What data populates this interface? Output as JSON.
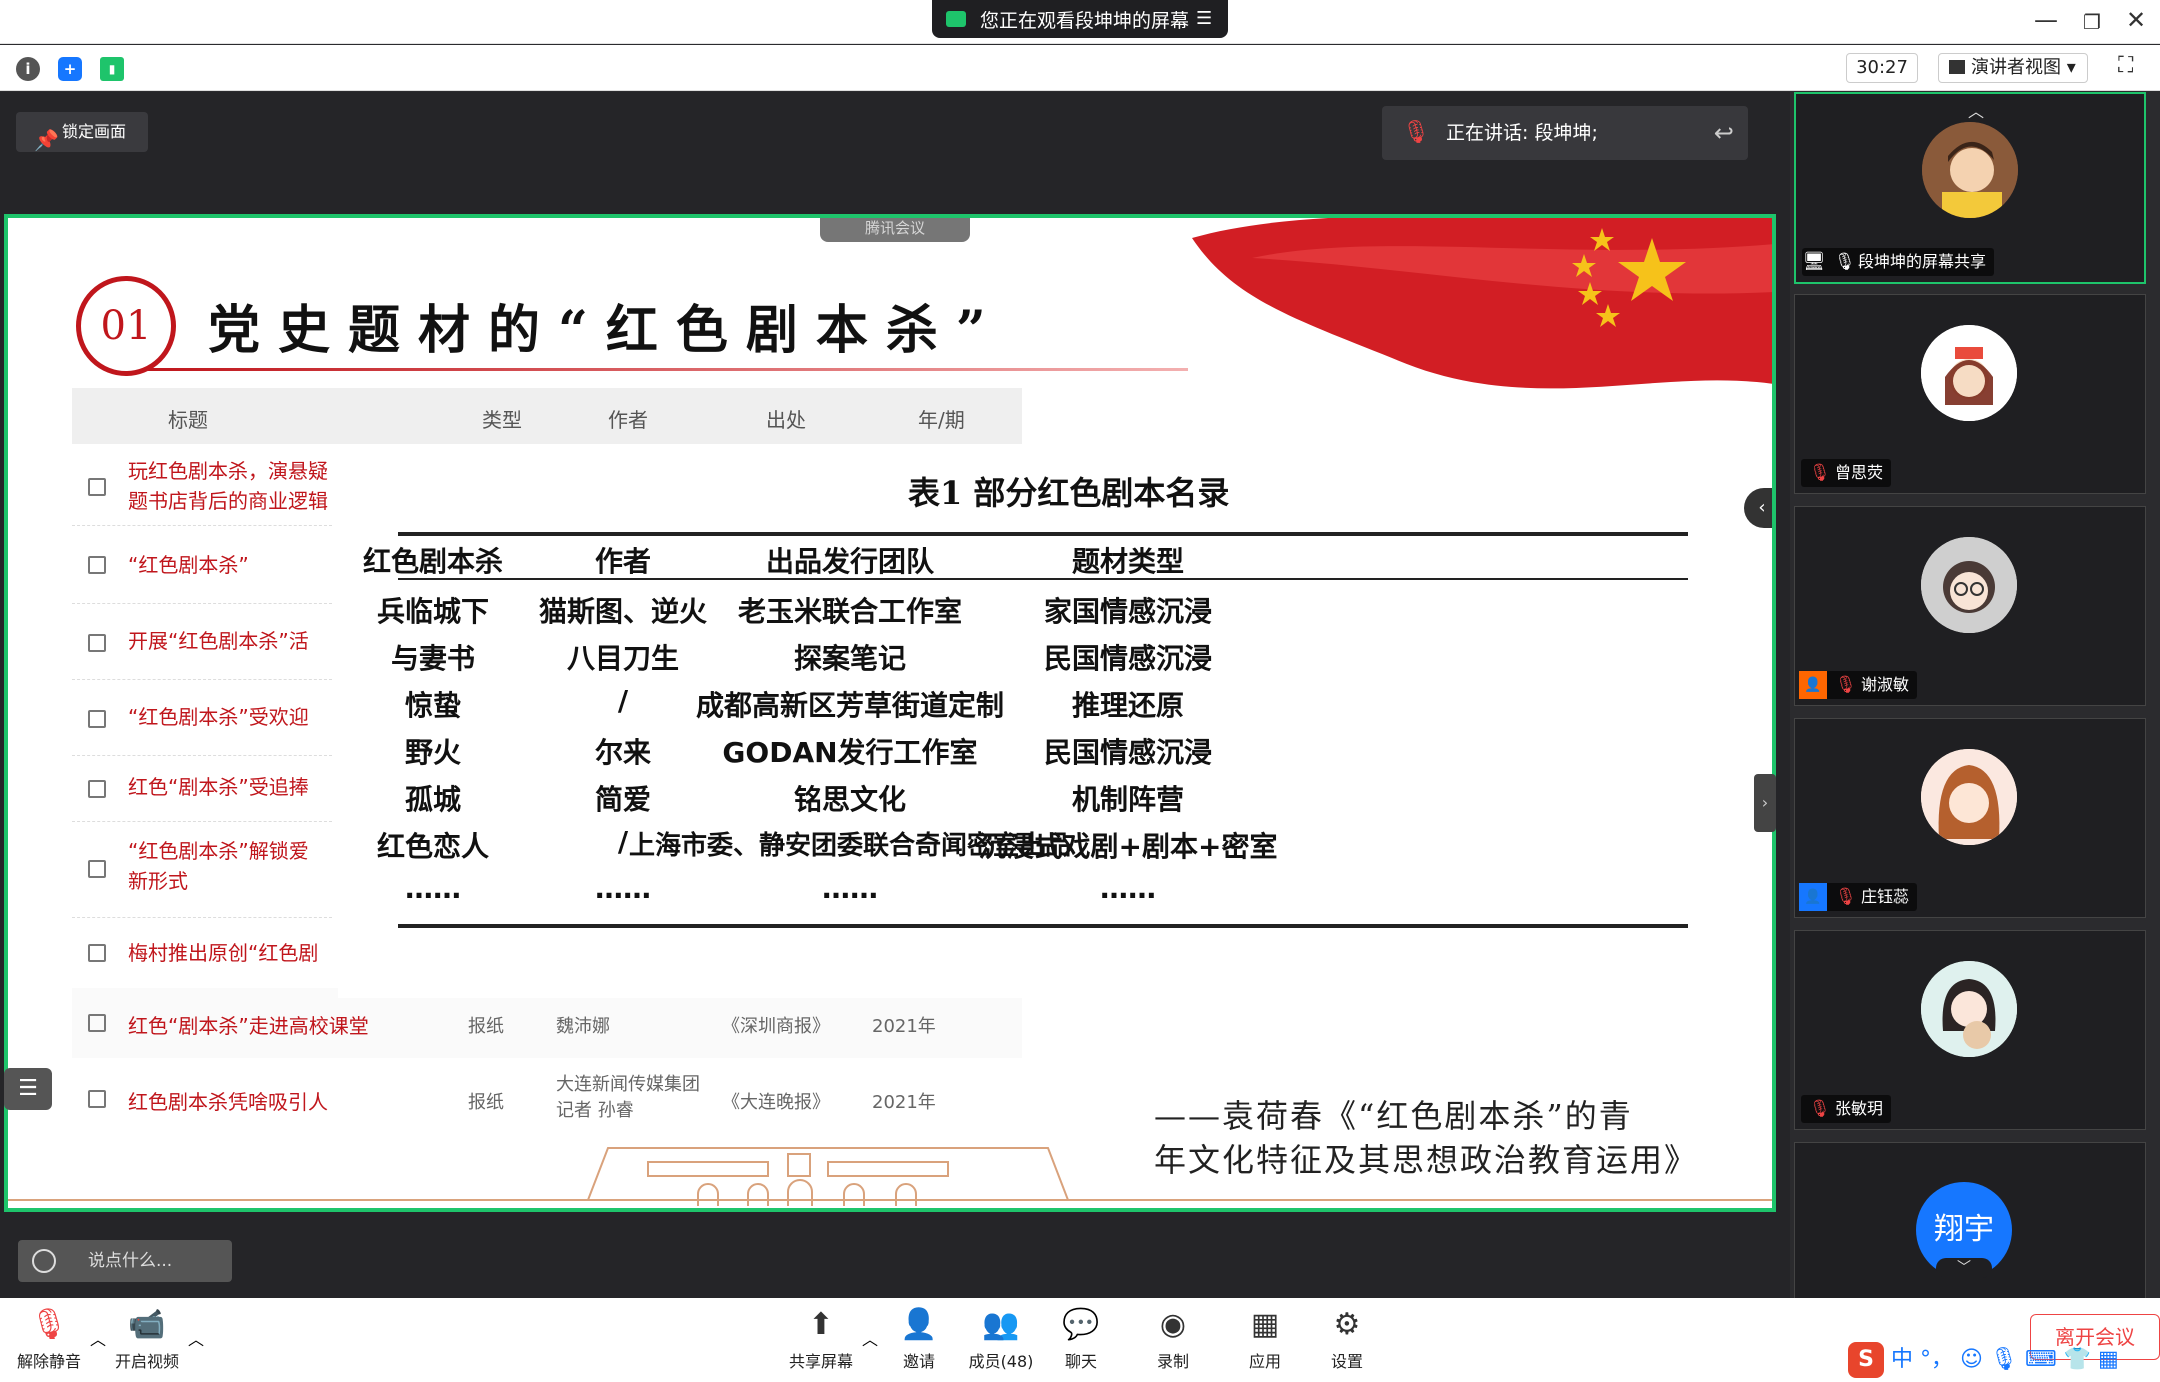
{
  "window": {
    "share_notice": "您正在观看段坤坤的屏幕"
  },
  "toolbar": {
    "timer": "30:27",
    "view_mode": "演讲者视图"
  },
  "stage": {
    "lock_label": "锁定画面",
    "speaking_label": "正在讲话: 段坤坤;"
  },
  "slide": {
    "app_badge": "腾讯会议",
    "number": "01",
    "title": "党史题材的“红色剧本杀”",
    "list_headers": [
      "标题",
      "类型",
      "作者",
      "出处",
      "年/期"
    ],
    "left_rows": [
      {
        "text": "玩红色剧本杀，演悬疑题书店背后的商业逻辑"
      },
      {
        "text": "“红色剧本杀”"
      },
      {
        "text": "开展“红色剧本杀”活"
      },
      {
        "text": "“红色剧本杀”受欢迎"
      },
      {
        "text": "红色“剧本杀”受追捧"
      },
      {
        "text": "“红色剧本杀”解锁爱新形式"
      },
      {
        "text": "梅村推出原创“红色剧"
      }
    ],
    "bottom_rows": [
      {
        "title": "红色“剧本杀”走进高校课堂",
        "type": "报纸",
        "author": "魏沛娜",
        "source": "《深圳商报》",
        "year": "2021年"
      },
      {
        "title": "红色剧本杀凭啥吸引人",
        "type": "报纸",
        "author": "大连新闻传媒集团 记者 孙睿",
        "source": "《大连晚报》",
        "year": "2021年"
      }
    ],
    "table": {
      "title": "表1  部分红色剧本名录",
      "headers": [
        "红色剧本杀",
        "作者",
        "出品发行团队",
        "题材类型"
      ],
      "rows": [
        [
          "兵临城下",
          "猫斯图、逆火",
          "老玉米联合工作室",
          "家国情感沉浸"
        ],
        [
          "与妻书",
          "八目刀生",
          "探案笔记",
          "民国情感沉浸"
        ],
        [
          "惊蛰",
          "/",
          "成都高新区芳草街道定制",
          "推理还原"
        ],
        [
          "野火",
          "尔来",
          "GODAN发行工作室",
          "民国情感沉浸"
        ],
        [
          "孤城",
          "简爱",
          "铭思文化",
          "机制阵营"
        ],
        [
          "红色恋人",
          "/",
          "上海市委、静安团委联合奇闻密室出品",
          "沉浸式戏剧+剧本+密室"
        ],
        [
          "……",
          "……",
          "……",
          "……"
        ]
      ]
    },
    "quote_line1": "——袁荷春《“红色剧本杀”的青",
    "quote_line2": "年文化特征及其思想政治教育运用》",
    "chat_placeholder": "说点什么..."
  },
  "gallery": [
    {
      "name": "段坤坤的屏幕共享",
      "active": true
    },
    {
      "name": "曾思荧"
    },
    {
      "name": "谢淑敏"
    },
    {
      "name": "庄钰蕊"
    },
    {
      "name": "张敏玥"
    },
    {
      "name": "翔宇",
      "avatar_text": "翔宇"
    }
  ],
  "bottombar": {
    "mute": "解除静音",
    "video": "开启视频",
    "share": "共享屏幕",
    "invite": "邀请",
    "members": "成员(48)",
    "chat": "聊天",
    "record": "录制",
    "apps": "应用",
    "settings": "设置",
    "leave": "离开会议"
  },
  "ime": {
    "mode": "中"
  }
}
